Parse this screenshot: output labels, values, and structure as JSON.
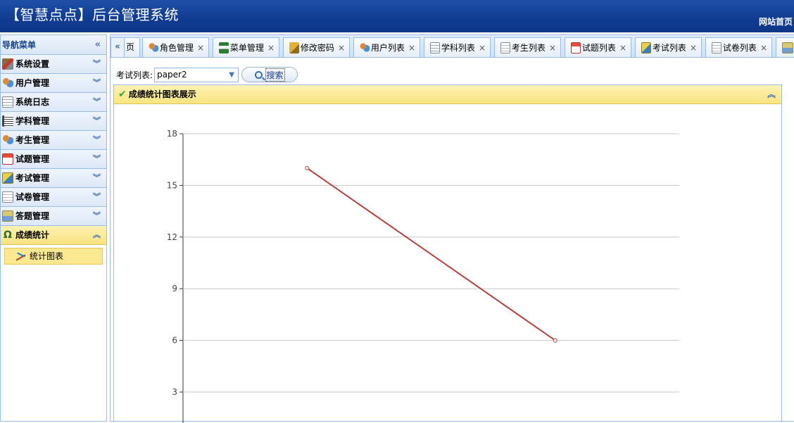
{
  "header": {
    "title": "【智慧点点】后台管理系统",
    "home_link": "网站首页"
  },
  "sidebar": {
    "title": "导航菜单",
    "items": [
      {
        "label": "系统设置",
        "icon": "tools-icon"
      },
      {
        "label": "用户管理",
        "icon": "users-icon"
      },
      {
        "label": "系统日志",
        "icon": "log-icon"
      },
      {
        "label": "学科管理",
        "icon": "list-icon"
      },
      {
        "label": "考生管理",
        "icon": "users-icon"
      },
      {
        "label": "试题管理",
        "icon": "calendar-icon"
      },
      {
        "label": "考试管理",
        "icon": "exam-icon"
      },
      {
        "label": "试卷管理",
        "icon": "paper-icon"
      },
      {
        "label": "答题管理",
        "icon": "answer-icon"
      },
      {
        "label": "成绩统计",
        "icon": "score-icon",
        "active": true
      }
    ],
    "sub_item": {
      "label": "统计图表",
      "icon": "chart-icon"
    }
  },
  "tabs": {
    "first_partial": "页",
    "items": [
      {
        "label": "角色管理"
      },
      {
        "label": "菜单管理"
      },
      {
        "label": "修改密码"
      },
      {
        "label": "用户列表"
      },
      {
        "label": "学科列表"
      },
      {
        "label": "考生列表"
      },
      {
        "label": "试题列表"
      },
      {
        "label": "考试列表"
      },
      {
        "label": "试卷列表"
      }
    ]
  },
  "toolbar": {
    "filter_label": "考试列表:",
    "select_value": "paper2",
    "search_label": "搜索"
  },
  "panel": {
    "title": "成绩统计图表展示"
  },
  "colors": {
    "line": "#b5423a",
    "header_bg": "#103d93",
    "active_bg": "#f9e27f"
  },
  "chart_data": {
    "type": "line",
    "x": [
      "",
      ""
    ],
    "values": [
      16,
      6
    ],
    "ylim": [
      3,
      18
    ],
    "yticks": [
      3,
      6,
      9,
      12,
      15,
      18
    ],
    "grid": true,
    "title": "",
    "xlabel": "",
    "ylabel": ""
  }
}
